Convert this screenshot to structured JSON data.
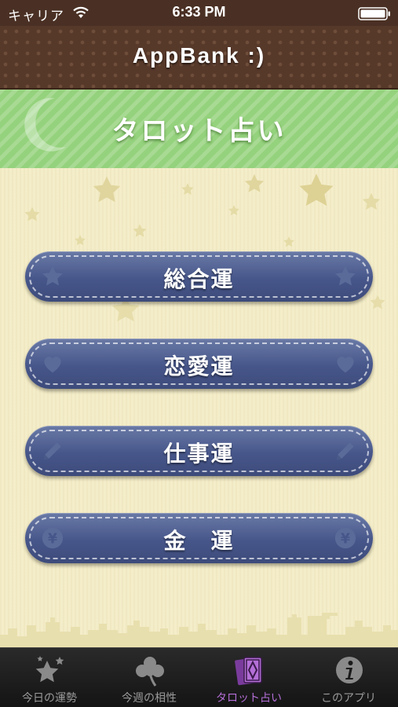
{
  "status_bar": {
    "carrier": "キャリア",
    "time": "6:33 PM"
  },
  "header": {
    "title": "AppBank :)"
  },
  "banner": {
    "title": "タロット占い"
  },
  "menu": [
    {
      "label": "総合運",
      "icon": "star-icon"
    },
    {
      "label": "恋愛運",
      "icon": "heart-icon"
    },
    {
      "label": "仕事運",
      "icon": "pencil-icon"
    },
    {
      "label": "金　運",
      "icon": "yen-icon"
    }
  ],
  "tabs": [
    {
      "label": "今日の運勢",
      "icon": "stars-icon",
      "active": false
    },
    {
      "label": "今週の相性",
      "icon": "clover-icon",
      "active": false
    },
    {
      "label": "タロット占い",
      "icon": "tarot-cards-icon",
      "active": true
    },
    {
      "label": "このアプリ",
      "icon": "info-icon",
      "active": false
    }
  ],
  "colors": {
    "header_brown": "#57392a",
    "banner_green": "#95d27d",
    "button_navy": "#47568a",
    "background_cream": "#f4edc9",
    "active_tab_purple": "#b46fd7"
  }
}
